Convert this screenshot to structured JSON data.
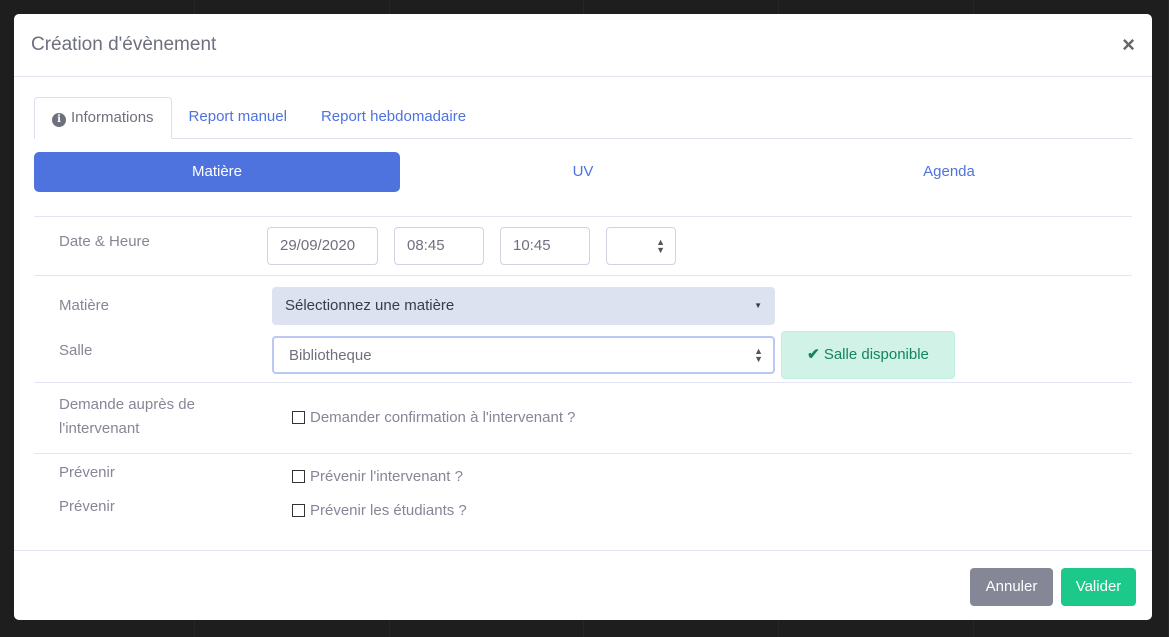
{
  "modal": {
    "title": "Création d'évènement",
    "close": "×"
  },
  "tabs": [
    {
      "label": "Informations",
      "icon": "info-circle-icon",
      "active": true
    },
    {
      "label": "Report manuel"
    },
    {
      "label": "Report hebdomadaire"
    }
  ],
  "pills": [
    {
      "label": "Matière",
      "active": true
    },
    {
      "label": "UV"
    },
    {
      "label": "Agenda"
    }
  ],
  "form": {
    "datetime": {
      "label": "Date & Heure",
      "date": "29/09/2020",
      "start": "08:45",
      "end": "10:45",
      "select": ""
    },
    "matiere": {
      "label": "Matière",
      "placeholder": "Sélectionnez une matière"
    },
    "salle": {
      "label": "Salle",
      "value": "Bibliotheque",
      "status": "Salle disponible"
    },
    "demande": {
      "label": "Demande auprès de l'intervenant",
      "checkbox": "Demander confirmation à l'intervenant ?",
      "checked": false
    },
    "prevenir1": {
      "label": "Prévenir",
      "checkbox": "Prévenir l'intervenant ?",
      "checked": false
    },
    "prevenir2": {
      "label": "Prévenir",
      "checkbox": "Prévenir les étudiants ?",
      "checked": false
    }
  },
  "footer": {
    "cancel": "Annuler",
    "submit": "Valider"
  },
  "colors": {
    "primary": "#4e73df",
    "success": "#1cc88a",
    "secondary": "#858796",
    "success_bg": "#d1f2e6"
  }
}
